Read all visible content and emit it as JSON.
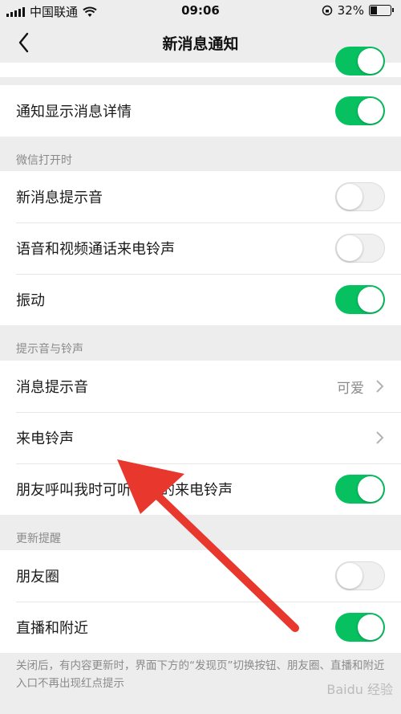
{
  "status_bar": {
    "carrier": "中国联通",
    "time": "09:06",
    "battery": "32%",
    "battery_level": 0.32
  },
  "nav": {
    "title": "新消息通知"
  },
  "top_card": {
    "row_label": "通知显示消息详情",
    "row_toggle": "on"
  },
  "sections": {
    "wechat_open": {
      "header": "微信打开时",
      "items": [
        {
          "label": "新消息提示音",
          "toggle": "off"
        },
        {
          "label": "语音和视频通话来电铃声",
          "toggle": "off"
        },
        {
          "label": "振动",
          "toggle": "on"
        }
      ]
    },
    "sounds": {
      "header": "提示音与铃声",
      "items": [
        {
          "label": "消息提示音",
          "value": "可爱"
        },
        {
          "label": "来电铃声"
        },
        {
          "label": "朋友呼叫我时可听到我的来电铃声",
          "toggle": "on"
        }
      ]
    },
    "updates": {
      "header": "更新提醒",
      "items": [
        {
          "label": "朋友圈",
          "toggle": "off"
        },
        {
          "label": "直播和附近",
          "toggle": "on"
        }
      ]
    }
  },
  "footnote": "关闭后，有内容更新时，界面下方的“发现页”切换按钮、朋友圈、直播和附近入口不再出现红点提示",
  "watermark": "Baidu 经验",
  "colors": {
    "accent_green": "#07c160",
    "background": "#ededed",
    "arrow_red": "#e8372c"
  },
  "icons": [
    "wifi-icon",
    "signal-icon",
    "lock-rotation-icon",
    "battery-icon",
    "back-icon",
    "chevron-right-icon",
    "red-arrow-annotation"
  ]
}
